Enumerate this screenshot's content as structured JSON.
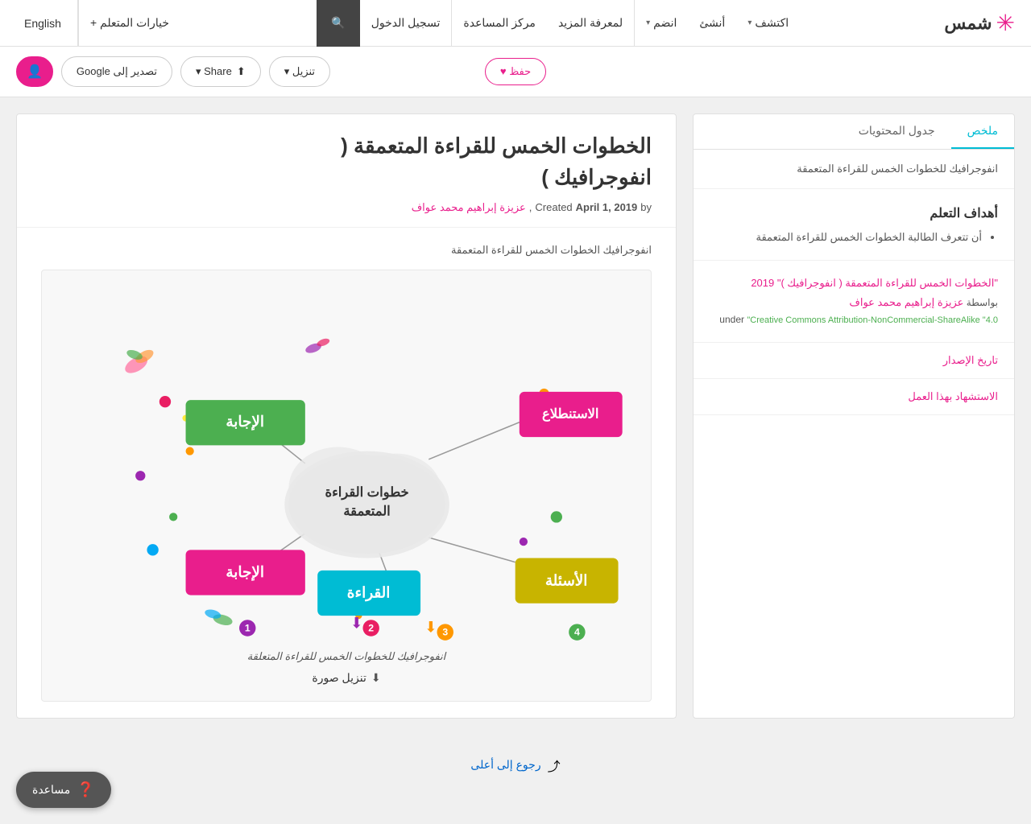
{
  "nav": {
    "logo_text": "شمس",
    "items": [
      {
        "label": "اكتشف",
        "has_chevron": true,
        "id": "discover"
      },
      {
        "label": "أنشئ",
        "has_chevron": false,
        "id": "create"
      },
      {
        "label": "انضم",
        "has_chevron": true,
        "id": "join"
      },
      {
        "label": "لمعرفة المزيد",
        "has_chevron": false,
        "id": "more"
      },
      {
        "label": "مركز المساعدة",
        "has_chevron": false,
        "id": "help-center"
      },
      {
        "label": "تسجيل الدخول",
        "has_chevron": false,
        "id": "login"
      },
      {
        "label": "✕",
        "has_chevron": false,
        "id": "search-icon-nav"
      }
    ],
    "english_label": "English",
    "learner_options": "خيارات المتعلم +"
  },
  "action_bar": {
    "save_label": "حفظ ♥",
    "download_label": "تنزيل ▾",
    "share_label": "Share ▾",
    "google_export_label": "تصدير إلى Google"
  },
  "sidebar": {
    "tab_summary": "ملخص",
    "tab_toc": "جدول المحتويات",
    "infographic_label": "انفوجرافيك للخطوات الخمس للقراءة المتعمقة",
    "goals_heading": "أهداف التعلم",
    "goals_items": [
      "أن تتعرف الطالبة الخطوات الخمس للقراءة المتعمقة"
    ],
    "copyright_title": "\"الخطوات الخمس للقراءة المتعمقة ( انفوجرافيك )\" 2019",
    "copyright_by": "بواسطة",
    "copyright_author": "عزيزة إبراهيم محمد عواف",
    "copyright_under": "under",
    "copyright_license": "\"Creative Commons Attribution-NonCommercial-ShareAlike \"4.0",
    "release_date_label": "تاريخ الإصدار",
    "cite_label": "الاستشهاد بهذا العمل"
  },
  "content": {
    "title_line1": "الخطوات الخمس للقراءة المتعمقة (",
    "title_line2": "انفوجرافيك )",
    "meta_author": "عزيزة إبراهيم محمد عواف",
    "meta_created": "Created",
    "meta_date": "April 1, 2019",
    "meta_by": "by",
    "infographic_caption_top": "انفوجرافيك الخطوات الخمس للقراءة المتعمقة",
    "infographic_caption_bottom": "انفوجرافيك للخطوات الخمس للقراءة المتعلقة",
    "download_image_label": "تنزيل صورة",
    "center_text_line1": "خطوات القراءة",
    "center_text_line2": "المتعمقة",
    "box_top_left": "الإجابة",
    "box_top_right": "الاستنطلاع",
    "box_bottom_left": "الإجابة",
    "box_bottom_center": "القراءة",
    "box_bottom_right": "الأسئلة"
  },
  "footer": {
    "back_to_top": "رجوع إلى أعلى"
  },
  "help": {
    "label": "مساعدة"
  }
}
